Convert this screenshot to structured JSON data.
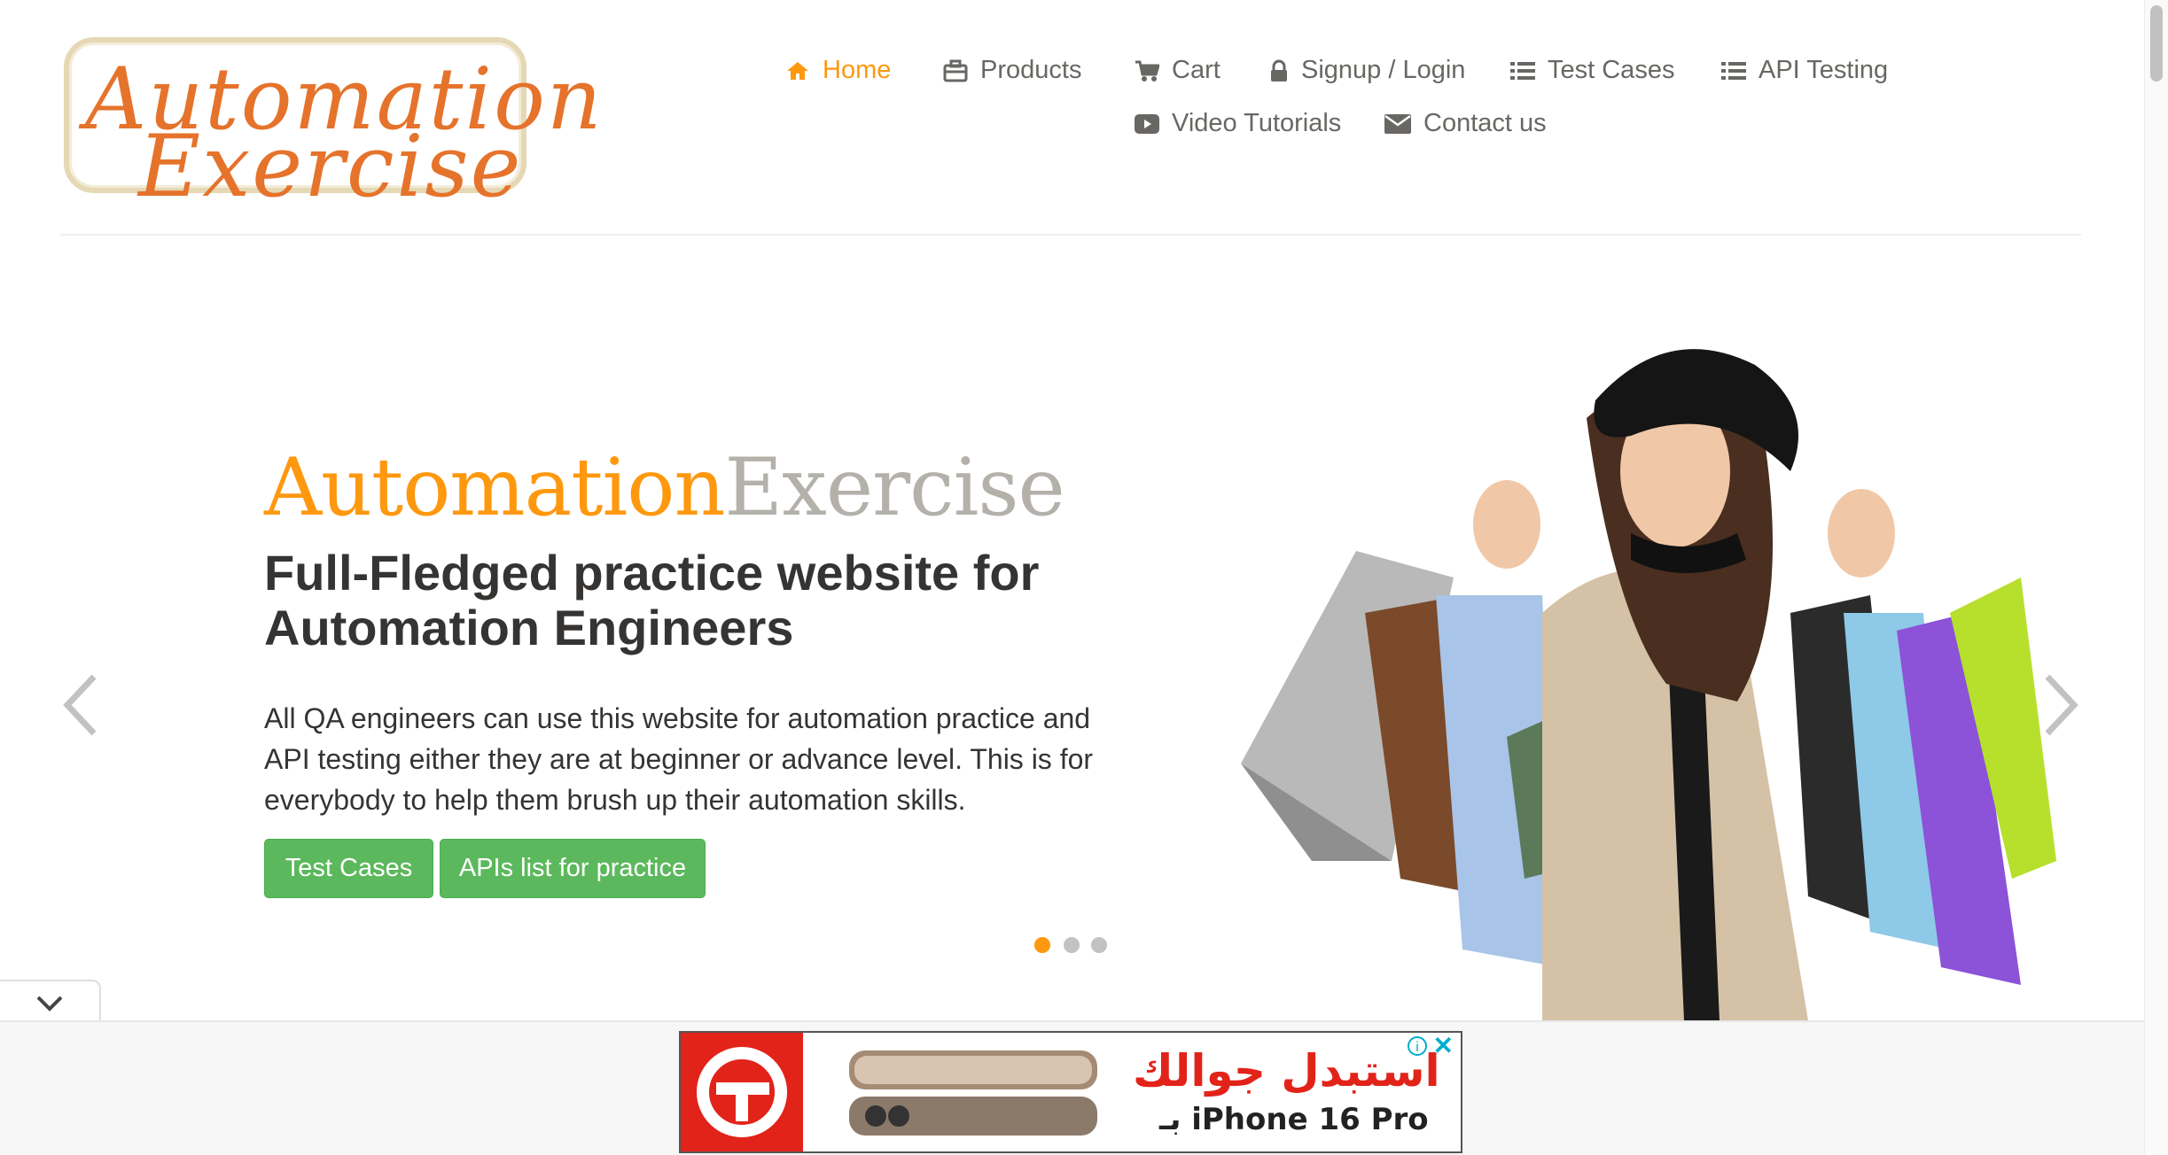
{
  "logo": {
    "line1": "Automation",
    "line2": "Exercise"
  },
  "nav": {
    "home": "Home",
    "products": "Products",
    "cart": "Cart",
    "signup_login": "Signup / Login",
    "test_cases": "Test Cases",
    "api_testing": "API Testing",
    "video_tutorials": "Video Tutorials",
    "contact_us": "Contact us"
  },
  "hero": {
    "brand_part1": "Automation",
    "brand_part2": "Exercise",
    "title": "Full-Fledged practice website for Automation Engineers",
    "description": "All QA engineers can use this website for automation practice and API testing either they are at beginner or advance level. This is for everybody to help them brush up their automation skills.",
    "btn_test_cases": "Test Cases",
    "btn_apis": "APIs list for practice",
    "active_slide": 1,
    "slide_count": 3
  },
  "ad": {
    "headline_ar": "استبدل جوالك",
    "subline": "بـ iPhone 16 Pro"
  },
  "colors": {
    "accent": "#fe980f",
    "nav_text": "#696763",
    "button_green": "#5cb85c",
    "brand_gray": "#b4b1ab"
  },
  "icons": {
    "home": "home-icon",
    "products": "briefcase-icon",
    "cart": "cart-icon",
    "login": "lock-icon",
    "test_cases": "list-icon",
    "api": "list-icon",
    "video": "youtube-play-icon",
    "contact": "envelope-icon"
  }
}
